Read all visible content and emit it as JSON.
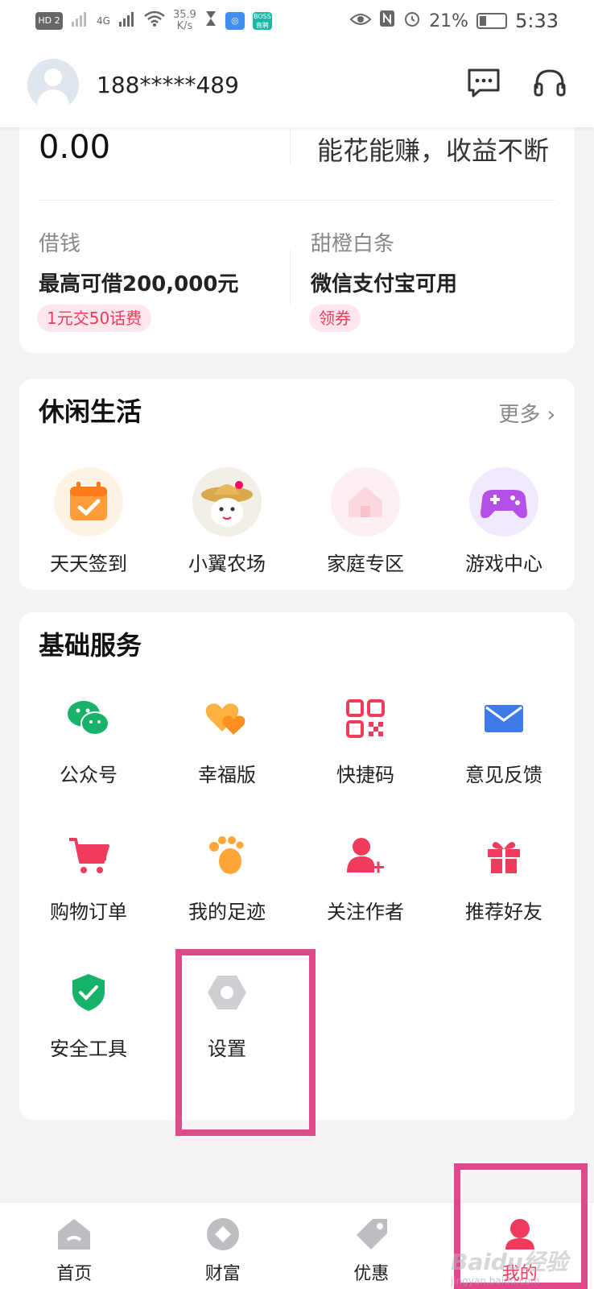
{
  "status_bar": {
    "left_badges": [
      "HD 2",
      "4G"
    ],
    "speed_value": "35.9",
    "speed_unit": "K/s",
    "boss_badge": "BOSS 直聘",
    "battery": "21%",
    "time": "5:33"
  },
  "header": {
    "phone": "188*****489",
    "message_icon": "message-icon",
    "service_icon": "headset-icon"
  },
  "wallet": {
    "balance": "0.00",
    "slogan": "能花能赚，收益不断",
    "borrow": {
      "label": "借钱",
      "headline": "最高可借200,000元",
      "tag": "1元交50话费"
    },
    "baitiao": {
      "label": "甜橙白条",
      "headline": "微信支付宝可用",
      "tag": "领券"
    }
  },
  "leisure": {
    "title": "休闲生活",
    "more": "更多",
    "items": [
      {
        "label": "天天签到",
        "icon": "calendar-check-icon"
      },
      {
        "label": "小翼农场",
        "icon": "farm-mascot-icon"
      },
      {
        "label": "家庭专区",
        "icon": "family-zone-icon"
      },
      {
        "label": "游戏中心",
        "icon": "gamepad-icon"
      }
    ]
  },
  "basic": {
    "title": "基础服务",
    "items": [
      {
        "label": "公众号",
        "icon": "wechat-icon",
        "color": "#1aad19"
      },
      {
        "label": "幸福版",
        "icon": "hearts-icon",
        "color": "#ff9a2e"
      },
      {
        "label": "快捷码",
        "icon": "qrcode-icon",
        "color": "#ef3b5c"
      },
      {
        "label": "意见反馈",
        "icon": "mail-icon",
        "color": "#3f7be8"
      },
      {
        "label": "购物订单",
        "icon": "cart-icon",
        "color": "#ef3b5c"
      },
      {
        "label": "我的足迹",
        "icon": "footprint-icon",
        "color": "#ff9a2e"
      },
      {
        "label": "关注作者",
        "icon": "follow-user-icon",
        "color": "#ef3b5c"
      },
      {
        "label": "推荐好友",
        "icon": "gift-icon",
        "color": "#ef3b5c"
      },
      {
        "label": "安全工具",
        "icon": "shield-check-icon",
        "color": "#17b26a"
      },
      {
        "label": "设置",
        "icon": "settings-icon",
        "color": "#c8c8cc"
      }
    ]
  },
  "tabbar": {
    "tabs": [
      {
        "label": "首页",
        "icon": "home-icon"
      },
      {
        "label": "财富",
        "icon": "wealth-icon"
      },
      {
        "label": "优惠",
        "icon": "coupon-tag-icon"
      },
      {
        "label": "我的",
        "icon": "profile-icon"
      }
    ],
    "active": "我的"
  },
  "watermark": {
    "brand": "Baidu经验",
    "url": "jingyan.baidu.com"
  },
  "colors": {
    "accent": "#ef3b5c",
    "highlight": "#e0488a",
    "background": "#f4f4f6"
  }
}
